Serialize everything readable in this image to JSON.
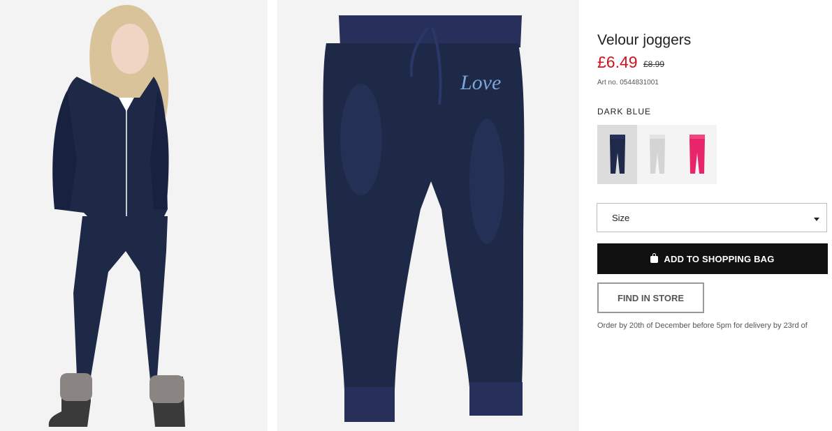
{
  "product": {
    "title": "Velour joggers",
    "price_now": "£6.49",
    "price_old": "£8.99",
    "article": "Art no. 0544831001",
    "color_name": "DARK BLUE",
    "swatches": [
      {
        "name": "dark-blue",
        "color": "#1f2a4a",
        "selected": true
      },
      {
        "name": "light-grey",
        "color": "#d9d9d9",
        "selected": false
      },
      {
        "name": "pink",
        "color": "#e8246a",
        "selected": false
      }
    ]
  },
  "size_select": {
    "label": "Size"
  },
  "actions": {
    "add_to_bag": "ADD TO SHOPPING BAG",
    "find_in_store": "FIND IN STORE"
  },
  "delivery_note": "Order by 20th of December before 5pm for delivery by 23rd of",
  "images": {
    "product_print": "Love"
  },
  "colors": {
    "sale_red": "#d0131f",
    "velour_navy": "#1e2847",
    "button_black": "#111111"
  }
}
